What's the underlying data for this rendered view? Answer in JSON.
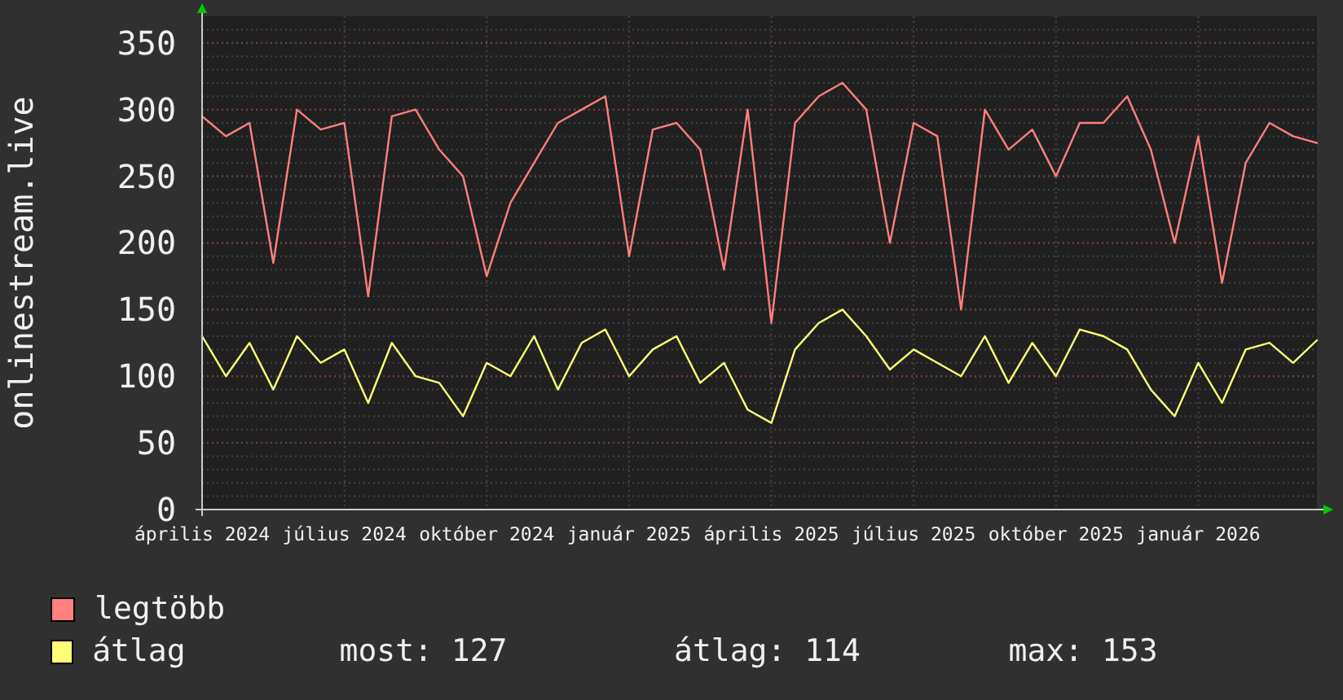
{
  "chart": {
    "chart_data": {
      "type": "line",
      "grid": true,
      "ylabel": "onlinestream.live",
      "ylim": [
        0,
        370
      ],
      "yticks": [
        0,
        50,
        100,
        150,
        200,
        250,
        300,
        350
      ],
      "categories": [
        "április 2024",
        null,
        null,
        null,
        null,
        null,
        "július 2024",
        null,
        null,
        null,
        null,
        null,
        "október 2024",
        null,
        null,
        null,
        null,
        null,
        "január 2025",
        null,
        null,
        null,
        null,
        null,
        "április 2025",
        null,
        null,
        null,
        null,
        null,
        "július 2025",
        null,
        null,
        null,
        null,
        null,
        "október 2025",
        null,
        null,
        null,
        null,
        null,
        "január 2026",
        null,
        null,
        null,
        null,
        null
      ],
      "series": [
        {
          "name": "legtöbb",
          "color": "#ff7f7f",
          "values": [
            295,
            280,
            290,
            185,
            300,
            285,
            290,
            160,
            295,
            300,
            270,
            250,
            175,
            230,
            260,
            290,
            300,
            310,
            190,
            285,
            290,
            270,
            180,
            300,
            140,
            290,
            310,
            320,
            300,
            200,
            290,
            280,
            150,
            300,
            270,
            285,
            250,
            290,
            290,
            310,
            270,
            200,
            280,
            170,
            260,
            290,
            280,
            275
          ]
        },
        {
          "name": "átlag",
          "color": "#ffff77",
          "values": [
            130,
            100,
            125,
            90,
            130,
            110,
            120,
            80,
            125,
            100,
            95,
            70,
            110,
            100,
            130,
            90,
            125,
            135,
            100,
            120,
            130,
            95,
            110,
            75,
            65,
            120,
            140,
            150,
            130,
            105,
            120,
            110,
            100,
            130,
            95,
            125,
            100,
            135,
            130,
            120,
            90,
            70,
            110,
            80,
            120,
            125,
            110,
            127
          ]
        }
      ]
    }
  },
  "stats": [
    "most: 127",
    "átlag: 114",
    "max: 153"
  ]
}
